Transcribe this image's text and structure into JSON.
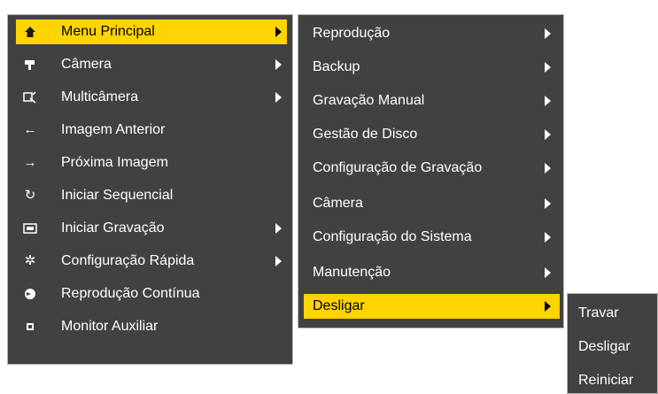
{
  "main_menu": {
    "items": [
      {
        "label": "Menu Principal",
        "icon": "home-icon",
        "submenu": true,
        "highlighted": true
      },
      {
        "label": "Câmera",
        "icon": "camera-icon",
        "submenu": true
      },
      {
        "label": "Multicâmera",
        "icon": "multicamera-icon",
        "submenu": true
      },
      {
        "label": "Imagem Anterior",
        "icon": "arrow-left-icon"
      },
      {
        "label": "Próxima Imagem",
        "icon": "arrow-right-icon"
      },
      {
        "label": "Iniciar Sequencial",
        "icon": "refresh-icon"
      },
      {
        "label": "Iniciar Gravação",
        "icon": "record-icon",
        "submenu": true
      },
      {
        "label": "Configuração Rápida",
        "icon": "gear-icon",
        "submenu": true
      },
      {
        "label": "Reprodução Contínua",
        "icon": "playback-icon"
      },
      {
        "label": "Monitor Auxiliar",
        "icon": "monitor-icon"
      }
    ]
  },
  "sub_menu": {
    "items": [
      {
        "label": "Reprodução"
      },
      {
        "label": "Backup"
      },
      {
        "label": "Gravação Manual"
      },
      {
        "label": "Gestão de Disco"
      },
      {
        "label": "Configuração de Gravação"
      },
      {
        "label": "Câmera"
      },
      {
        "label": "Configuração do Sistema"
      },
      {
        "label": "Manutenção"
      },
      {
        "label": "Desligar",
        "highlighted": true
      }
    ]
  },
  "power_menu": {
    "items": [
      {
        "label": "Travar"
      },
      {
        "label": "Desligar"
      },
      {
        "label": "Reiniciar"
      }
    ]
  },
  "colors": {
    "menu_bg": "#414141",
    "highlight": "#ffd400",
    "text": "#ffffff",
    "highlight_text": "#000000"
  }
}
